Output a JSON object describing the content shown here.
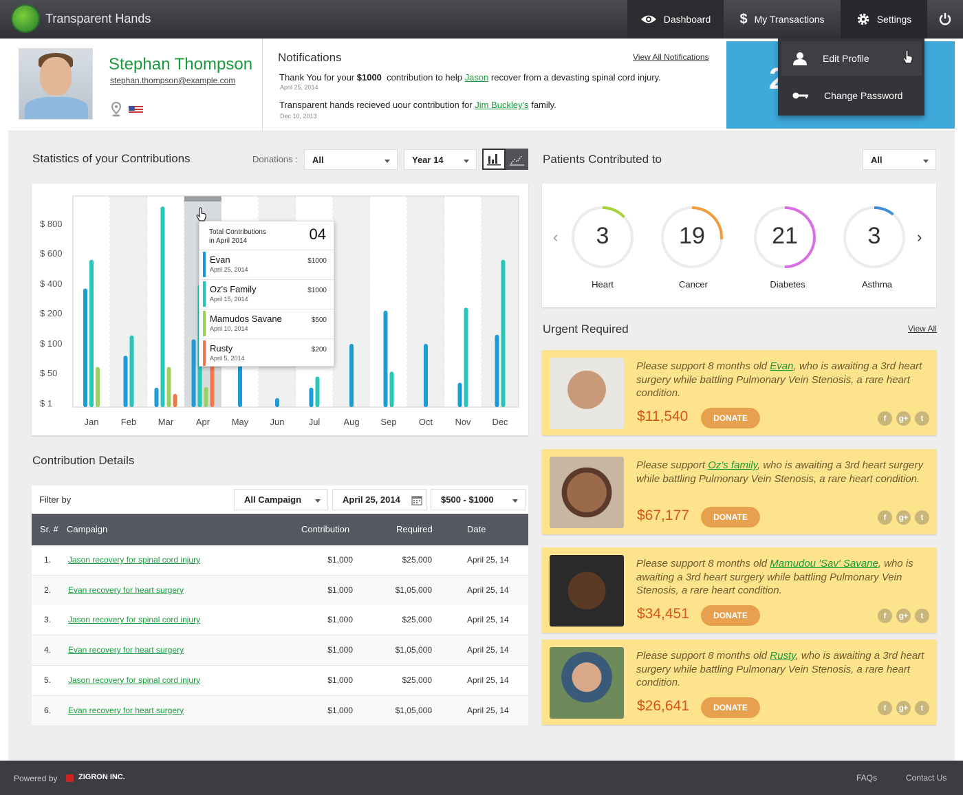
{
  "header": {
    "app_title": "Transparent Hands",
    "nav": {
      "dashboard": "Dashboard",
      "transactions": "My Transactions",
      "settings": "Settings"
    }
  },
  "settings_menu": {
    "edit_profile": "Edit Profile",
    "change_password": "Change Password"
  },
  "profile": {
    "name": "Stephan Thompson",
    "email": "stephan.thompson@example.com"
  },
  "blue_panel": {
    "value": "2"
  },
  "notifications": {
    "title": "Notifications",
    "view_all": "View All Notifications",
    "items": [
      {
        "pre": "Thank You for your ",
        "amount": "$1000",
        "mid": "  contribution to help ",
        "link": "Jason",
        "post": " recover from a devasting spinal cord injury.",
        "date": "April 25, 2014"
      },
      {
        "pre": "Transparent hands recieved uour contribution for ",
        "link": "Jim Buckley's",
        "post": " family.",
        "date": "Dec 10, 2013"
      }
    ]
  },
  "stats": {
    "title": "Statistics of your Contributions",
    "donations_label": "Donations :",
    "donations_value": "All",
    "year_value": "Year 14"
  },
  "chart_data": {
    "type": "bar",
    "title": "",
    "y_ticks": [
      "$ 800",
      "$ 600",
      "$ 400",
      "$ 200",
      "$ 100",
      "$ 50",
      "$ 1"
    ],
    "categories": [
      "Jan",
      "Feb",
      "Mar",
      "Apr",
      "May",
      "Jun",
      "Jul",
      "Aug",
      "Sep",
      "Oct",
      "Nov",
      "Dec"
    ],
    "series": [
      {
        "color": "#1e9ad6",
        "values": [
          370,
          80,
          27,
          115,
          380,
          10,
          27,
          100,
          220,
          100,
          35,
          130
        ]
      },
      {
        "color": "#27c6b8",
        "values": [
          560,
          128,
          920,
          395,
          null,
          null,
          45,
          null,
          53,
          null,
          240,
          560
        ]
      },
      {
        "color": "#9bd05c",
        "values": [
          61,
          null,
          61,
          28,
          null,
          null,
          null,
          null,
          null,
          null,
          null,
          null
        ]
      },
      {
        "color": "#ef7a4d",
        "values": [
          null,
          null,
          17,
          140,
          null,
          null,
          null,
          null,
          null,
          null,
          null,
          null
        ]
      }
    ],
    "highlight_month": "Apr",
    "tooltip": {
      "title_line1": "Total Contributions",
      "title_line2": "in April 2014",
      "count": "04",
      "items": [
        {
          "name": "Evan",
          "date": "April 25, 2014",
          "amount": "$1000",
          "color": "#1e9ad6"
        },
        {
          "name": "Oz's Family",
          "date": "April 15, 2014",
          "amount": "$1000",
          "color": "#27c6b8"
        },
        {
          "name": "Mamudos Savane",
          "date": "April 10, 2014",
          "amount": "$500",
          "color": "#9bd05c"
        },
        {
          "name": "Rusty",
          "date": "April 5, 2014",
          "amount": "$200",
          "color": "#ef7a4d"
        }
      ]
    }
  },
  "patients": {
    "title": "Patients Contributed to",
    "filter_value": "All",
    "rings": [
      {
        "label": "Heart",
        "count": "3",
        "color": "#a6d23a",
        "fraction": 0.13
      },
      {
        "label": "Cancer",
        "count": "19",
        "color": "#f19c3d",
        "fraction": 0.26
      },
      {
        "label": "Diabetes",
        "count": "21",
        "color": "#d96fe4",
        "fraction": 0.5
      },
      {
        "label": "Asthma",
        "count": "3",
        "color": "#3f8fdb",
        "fraction": 0.11
      }
    ]
  },
  "urgent": {
    "title": "Urgent Required",
    "view_all": "View All",
    "donate_label": "DONATE",
    "items": [
      {
        "pre": "Please support 8 months old ",
        "link": "Evan",
        "post": ", who is awaiting a 3rd heart surgery while battling Pulmonary Vein Stenosis, a rare heart condition.",
        "amount": "$11,540"
      },
      {
        "pre": "Please support ",
        "link": "Oz's family",
        "post": ", who is awaiting a 3rd heart surgery while battling Pulmonary Vein Stenosis, a rare heart condition.",
        "amount": "$67,177"
      },
      {
        "pre": "Please support 8 months old ",
        "link": "Mamudou 'Sav' Savane",
        "post": ", who is awaiting a 3rd heart surgery while battling Pulmonary Vein Stenosis, a rare heart condition.",
        "amount": "$34,451"
      },
      {
        "pre": "Please support 8 months old ",
        "link": "Rusty",
        "post": ", who is awaiting a 3rd heart surgery while battling Pulmonary Vein Stenosis, a rare heart condition.",
        "amount": "$26,641"
      }
    ]
  },
  "details": {
    "title": "Contribution Details",
    "filter_label": "Filter by",
    "campaign_filter": "All Campaign",
    "date_filter": "April 25, 2014",
    "range_filter": "$500 - $1000",
    "columns": [
      "Sr. #",
      "Campaign",
      "Contribution",
      "Required",
      "Date"
    ],
    "rows": [
      {
        "sr": "1.",
        "campaign": "Jason recovery for spinal cord injury",
        "contribution": "$1,000",
        "required": "$25,000",
        "date": "April 25, 14"
      },
      {
        "sr": "2.",
        "campaign": "Evan recovery for heart surgery",
        "contribution": "$1,000",
        "required": "$1,05,000",
        "date": "April 25, 14"
      },
      {
        "sr": "3.",
        "campaign": "Jason recovery for spinal cord injury",
        "contribution": "$1,000",
        "required": "$25,000",
        "date": "April 25, 14"
      },
      {
        "sr": "4.",
        "campaign": "Evan recovery for heart surgery",
        "contribution": "$1,000",
        "required": "$1,05,000",
        "date": "April 25, 14"
      },
      {
        "sr": "5.",
        "campaign": "Jason recovery for spinal cord injury",
        "contribution": "$1,000",
        "required": "$25,000",
        "date": "April 25, 14"
      },
      {
        "sr": "6.",
        "campaign": "Evan recovery for heart surgery",
        "contribution": "$1,000",
        "required": "$1,05,000",
        "date": "April 25, 14"
      }
    ]
  },
  "footer": {
    "powered_by": "Powered by",
    "company": "ZIGRON INC.",
    "faqs": "FAQs",
    "contact": "Contact Us"
  }
}
